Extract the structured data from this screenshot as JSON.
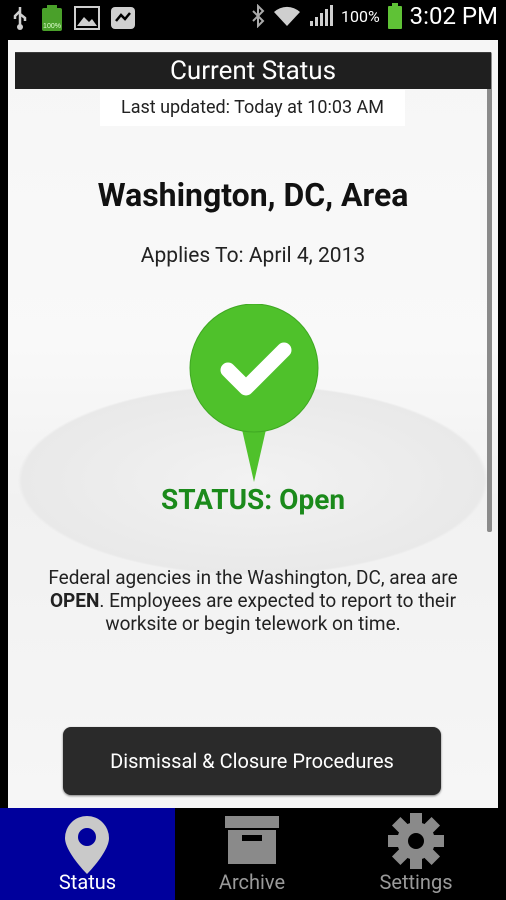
{
  "status_bar": {
    "battery_percent": "100%",
    "time": "3:02 PM",
    "battery_icon_small_text": "100%"
  },
  "header": {
    "title": "Current Status",
    "last_updated": "Last updated: Today at 10:03 AM"
  },
  "content": {
    "area": "Washington, DC, Area",
    "applies_to": "Applies To: April 4, 2013",
    "status": "STATUS: Open",
    "description_part1": "Federal agencies in the Washington, DC, area are ",
    "description_bold": "OPEN",
    "description_part2": ". Employees are expected to report to their worksite or begin telework on time.",
    "button_label": "Dismissal & Closure Procedures",
    "status_color": "#1b8a1b",
    "pin_color": "#4fc12b"
  },
  "tabs": [
    {
      "label": "Status",
      "icon": "location-pin-icon",
      "active": true
    },
    {
      "label": "Archive",
      "icon": "archive-box-icon",
      "active": false
    },
    {
      "label": "Settings",
      "icon": "gear-icon",
      "active": false
    }
  ]
}
